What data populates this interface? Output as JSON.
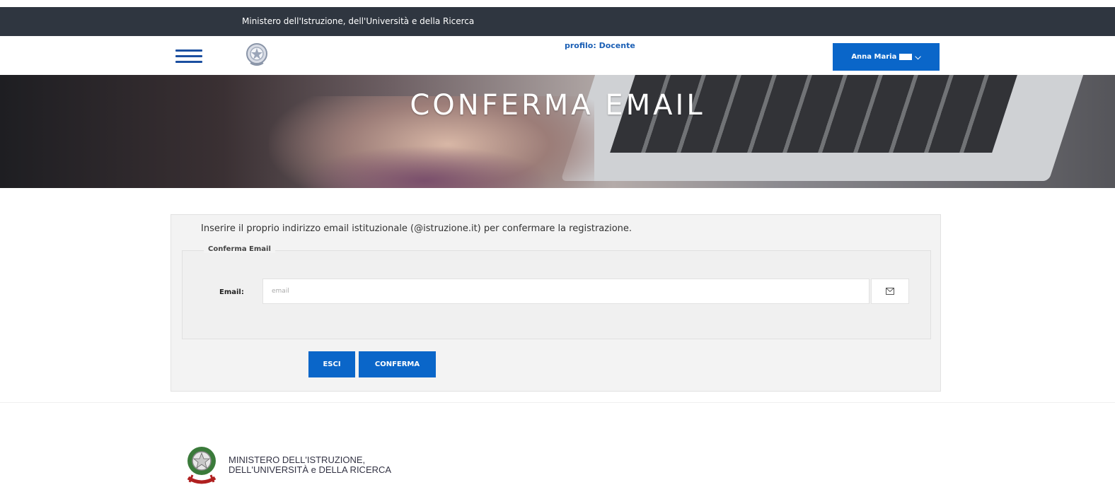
{
  "topbar": {
    "title": "Ministero dell'Istruzione, dell'Università e della Ricerca"
  },
  "navbar": {
    "profile": "profilo: Docente",
    "user_name": "Anna Maria",
    "menu_icon": "hamburger-menu-icon",
    "emblem_icon": "republic-emblem-icon"
  },
  "hero": {
    "title": "CONFERMA EMAIL"
  },
  "form": {
    "intro": "Inserire il proprio indirizzo email istituzionale (@istruzione.it) per confermare la registrazione.",
    "legend": "Conferma Email",
    "email_label": "Email:",
    "email_placeholder": "email",
    "email_value": "",
    "email_icon": "envelope-icon",
    "exit_label": "ESCI",
    "confirm_label": "CONFERMA"
  },
  "footer": {
    "line1": "MINISTERO DELL'ISTRUZIONE,",
    "line2": "DELL'UNIVERSITÀ e DELLA RICERCA"
  },
  "colors": {
    "topbar": "#2f3640",
    "primary": "#0a66c9",
    "panel": "#f3f3f3"
  }
}
